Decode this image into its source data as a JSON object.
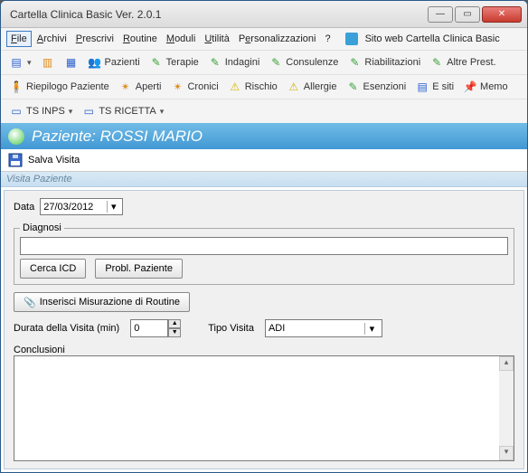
{
  "window": {
    "title": "Cartella Clinica Basic Ver. 2.0.1"
  },
  "menu": {
    "file": "File",
    "archivi": "Archivi",
    "prescrivi": "Prescrivi",
    "routine": "Routine",
    "moduli": "Moduli",
    "utilita": "Utilità",
    "personalizzazioni": "Personalizzazioni",
    "help": "?",
    "sitoweb": "Sito web Cartella Clinica Basic"
  },
  "toolbar1": {
    "pazienti": "Pazienti",
    "terapie": "Terapie",
    "indagini": "Indagini",
    "consulenze": "Consulenze",
    "riabilitazioni": "Riabilitazioni",
    "altre_prest": "Altre Prest."
  },
  "toolbar2": {
    "riepilogo_paziente": "Riepilogo Paziente",
    "aperti": "Aperti",
    "cronici": "Cronici",
    "rischio": "Rischio",
    "allergie": "Allergie",
    "esenzioni": "Esenzioni",
    "esiti": "E siti",
    "memo": "Memo"
  },
  "toolbar3": {
    "ts_inps": "TS INPS",
    "ts_ricetta": "TS RICETTA"
  },
  "patient": {
    "prefix": "Paziente:",
    "name": "ROSSI MARIO"
  },
  "save": {
    "label": "Salva Visita"
  },
  "section": {
    "visita": "Visita Paziente"
  },
  "form": {
    "data_label": "Data",
    "data_value": "27/03/2012",
    "diagnosi_legend": "Diagnosi",
    "diagnosi_value": "",
    "cerca_icd": "Cerca ICD",
    "probl_paziente": "Probl. Paziente",
    "inserisci_misurazione": "Inserisci Misurazione di Routine",
    "durata_label": "Durata della Visita (min)",
    "durata_value": "0",
    "tipo_visita_label": "Tipo Visita",
    "tipo_visita_value": "ADI",
    "conclusioni_label": "Conclusioni",
    "conclusioni_value": ""
  }
}
